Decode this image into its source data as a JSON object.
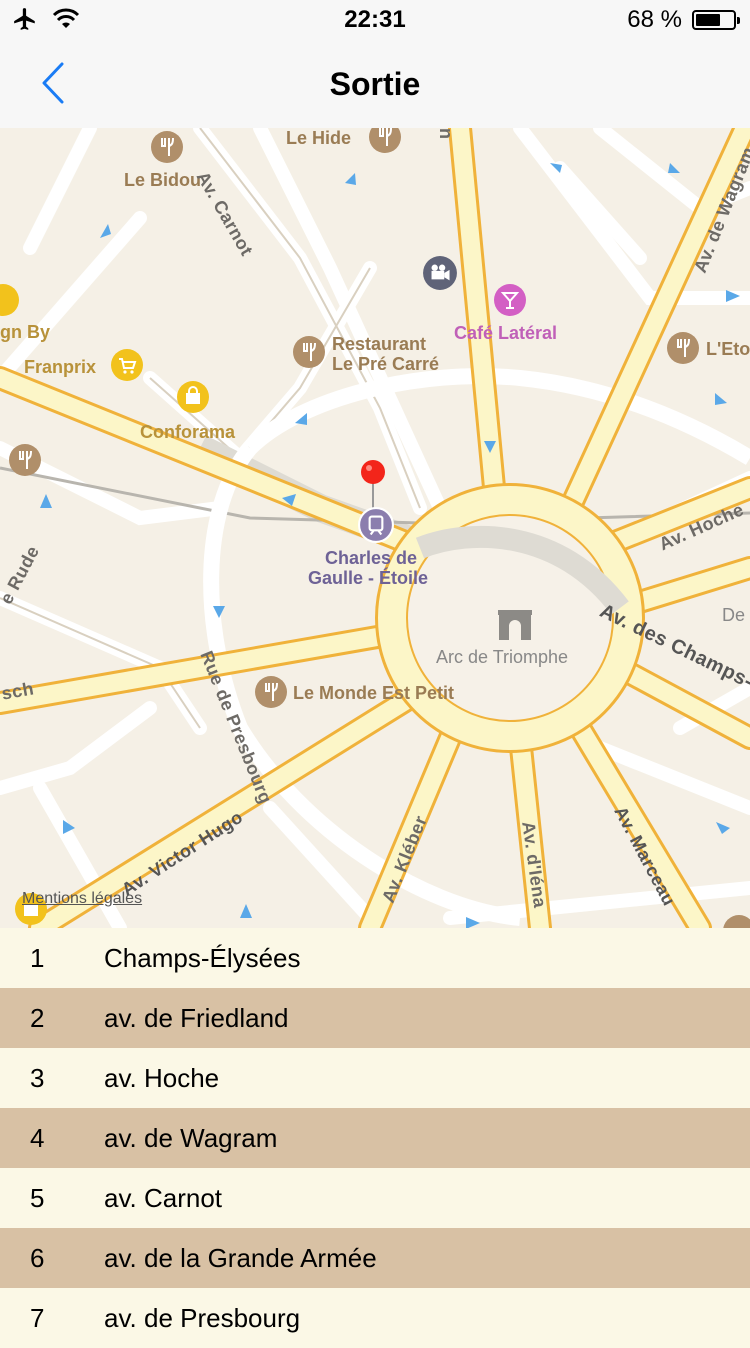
{
  "status_bar": {
    "time": "22:31",
    "battery_text": "68 %",
    "battery_level": 0.68
  },
  "nav": {
    "title": "Sortie"
  },
  "map": {
    "pois": {
      "le_hide": "Le Hide",
      "le_bidou": "Le Bidou",
      "gn_by": "gn By",
      "franprix": "Franprix",
      "conforama": "Conforama",
      "restaurant_l1": "Restaurant",
      "restaurant_l2": "Le Pré Carré",
      "cafe_lateral": "Café Latéral",
      "l_eto": "L'Eto",
      "station_l1": "Charles de",
      "station_l2": "Gaulle - Étoile",
      "arc": "Arc de Triomphe",
      "monde": "Le Monde Est Petit",
      "de": "De"
    },
    "streets": {
      "carnot": "Av. Carnot",
      "wagram": "Av. de Wagram",
      "hoche": "Av. Hoche",
      "champs": "Av. des Champs-É",
      "rude": "e Rude",
      "sch": "sch",
      "presbourg": "Rue de Presbourg",
      "hugo": "Av. Victor Hugo",
      "kleber": "Av. Kléber",
      "iena": "Av. d'Iéna",
      "marceau": "Av. Marceau",
      "n": "n"
    },
    "legal": "Mentions légales"
  },
  "exits": [
    {
      "num": "1",
      "name": "Champs-Élysées"
    },
    {
      "num": "2",
      "name": "av. de Friedland"
    },
    {
      "num": "3",
      "name": "av. Hoche"
    },
    {
      "num": "4",
      "name": "av. de Wagram"
    },
    {
      "num": "5",
      "name": "av. Carnot"
    },
    {
      "num": "6",
      "name": "av. de la Grande Armée"
    },
    {
      "num": "7",
      "name": "av. de Presbourg"
    }
  ]
}
